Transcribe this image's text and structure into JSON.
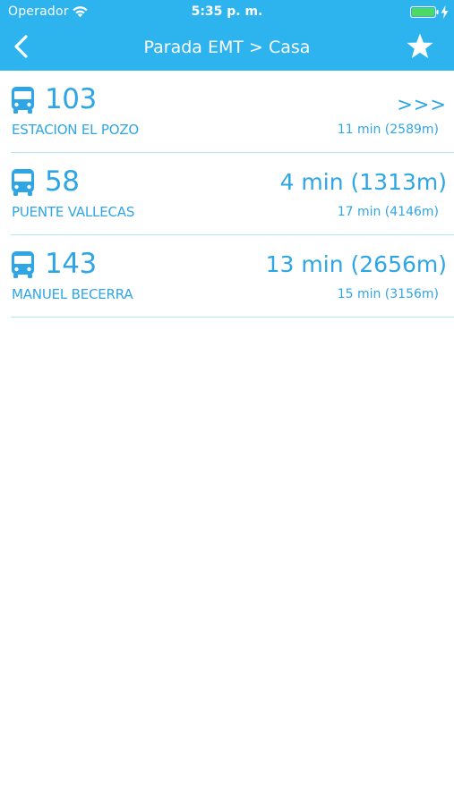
{
  "status_bar": {
    "carrier": "Operador",
    "time": "5:35 p. m."
  },
  "nav": {
    "title": "Parada EMT > Casa",
    "back_icon": "chevron-left-icon",
    "favorite_icon": "star-icon"
  },
  "colors": {
    "header": "#2db4ef",
    "accent": "#2ea6e6",
    "divider": "#b6e4f8",
    "battery": "#4cd964"
  },
  "arrivals": [
    {
      "line": "103",
      "destination": "ESTACION EL POZO",
      "next": ">>>",
      "later": "11 min (2589m)"
    },
    {
      "line": "58",
      "destination": "PUENTE VALLECAS",
      "next": "4 min (1313m)",
      "later": "17 min (4146m)"
    },
    {
      "line": "143",
      "destination": "MANUEL BECERRA",
      "next": "13 min (2656m)",
      "later": "15 min (3156m)"
    }
  ]
}
